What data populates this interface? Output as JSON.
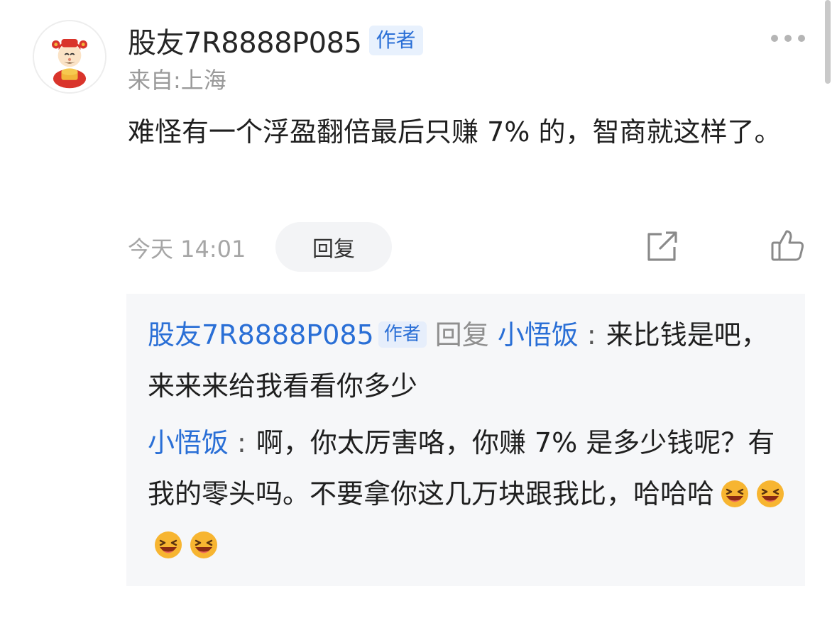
{
  "comment": {
    "author": "股友7R8888P085",
    "author_badge": "作者",
    "location": "来自:上海",
    "text": "难怪有一个浮盈翻倍最后只赚 7% 的，智商就这样了。",
    "time": "今天 14:01",
    "reply_label": "回复"
  },
  "replies": [
    {
      "author": "股友7R8888P085",
      "badge": "作者",
      "reply_word": "回复",
      "target": "小悟饭",
      "colon": ":",
      "text": "来比钱是吧，来来来给我看看你多少"
    },
    {
      "author": "小悟饭",
      "colon": ":",
      "text": "啊，你太厉害咯，你赚 7% 是多少钱呢？有我的零头吗。不要拿你这几万块跟我比，哈哈哈"
    }
  ],
  "icons": {
    "more": "more-dots-icon",
    "share": "share-icon",
    "like": "thumbs-up-icon",
    "emoji": "laughing-emoji-icon"
  },
  "colors": {
    "accent": "#2a6fd6",
    "badge_bg": "#e8f1fd",
    "muted": "#9a9a9a",
    "reply_bg": "#f6f7f9"
  }
}
